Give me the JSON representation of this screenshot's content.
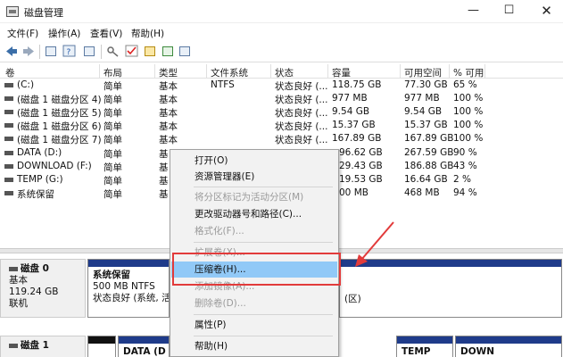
{
  "window": {
    "title": "磁盘管理",
    "minimize_glyph": "—",
    "maximize_glyph": "☐",
    "close_glyph": "✕"
  },
  "menu": [
    "文件(F)",
    "操作(A)",
    "查看(V)",
    "帮助(H)"
  ],
  "toolbar_icons": [
    "back-icon",
    "forward-icon",
    "list-icon",
    "help-icon",
    "properties-icon",
    "key-icon",
    "check-icon",
    "folder-icon",
    "folder-up-icon",
    "display-icon"
  ],
  "volume_table": {
    "headers": [
      "卷",
      "布局",
      "类型",
      "文件系统",
      "状态",
      "容量",
      "可用空间",
      "% 可用"
    ],
    "rows": [
      [
        "(C:)",
        "简单",
        "基本",
        "NTFS",
        "状态良好 (...",
        "118.75 GB",
        "77.30 GB",
        "65 %"
      ],
      [
        "(磁盘 1 磁盘分区 4)",
        "简单",
        "基本",
        "",
        "状态良好 (...",
        "977 MB",
        "977 MB",
        "100 %"
      ],
      [
        "(磁盘 1 磁盘分区 5)",
        "简单",
        "基本",
        "",
        "状态良好 (...",
        "9.54 GB",
        "9.54 GB",
        "100 %"
      ],
      [
        "(磁盘 1 磁盘分区 6)",
        "简单",
        "基本",
        "",
        "状态良好 (...",
        "15.37 GB",
        "15.37 GB",
        "100 %"
      ],
      [
        "(磁盘 1 磁盘分区 7)",
        "简单",
        "基本",
        "",
        "状态良好 (...",
        "167.89 GB",
        "167.89 GB",
        "100 %"
      ],
      [
        "DATA (D:)",
        "简单",
        "基",
        "",
        "",
        "96.62 GB",
        "267.59 GB",
        "90 %"
      ],
      [
        "DOWNLOAD (F:)",
        "简单",
        "基",
        "",
        "",
        "29.43 GB",
        "186.88 GB",
        "43 %"
      ],
      [
        "TEMP (G:)",
        "简单",
        "基",
        "",
        "",
        "19.53 GB",
        "16.64 GB",
        "2 %"
      ],
      [
        "系统保留",
        "简单",
        "基",
        "",
        "",
        "00 MB",
        "468 MB",
        "94 %"
      ]
    ]
  },
  "disks": [
    {
      "title": "磁盘 0",
      "type": "基本",
      "size": "119.24 GB",
      "status": "联机",
      "partitions": [
        {
          "name": "系统保留",
          "detail": "500 MB NTFS",
          "status": "状态良好 (系统, 活"
        },
        {
          "name": "",
          "detail": "",
          "status": "(区)"
        }
      ]
    },
    {
      "title": "磁盘 1",
      "partitions_labels": [
        "DATA (D",
        "TEMP",
        "DOWN"
      ]
    }
  ],
  "context_menu": {
    "items": [
      {
        "label": "打开(O)",
        "enabled": true
      },
      {
        "label": "资源管理器(E)",
        "enabled": true
      },
      {
        "label": "将分区标记为活动分区(M)",
        "enabled": false
      },
      {
        "label": "更改驱动器号和路径(C)...",
        "enabled": true
      },
      {
        "label": "格式化(F)...",
        "enabled": false
      },
      {
        "label": "扩展卷(X)...",
        "enabled": false
      },
      {
        "label": "压缩卷(H)...",
        "enabled": true,
        "highlighted": true
      },
      {
        "label": "添加镜像(A)...",
        "enabled": false
      },
      {
        "label": "删除卷(D)...",
        "enabled": false
      },
      {
        "label": "属性(P)",
        "enabled": true
      },
      {
        "label": "帮助(H)",
        "enabled": true
      }
    ]
  },
  "colors": {
    "highlight": "#91c9f7",
    "annotation": "#e23b3b",
    "partition_bar": "#1f3b8a"
  }
}
